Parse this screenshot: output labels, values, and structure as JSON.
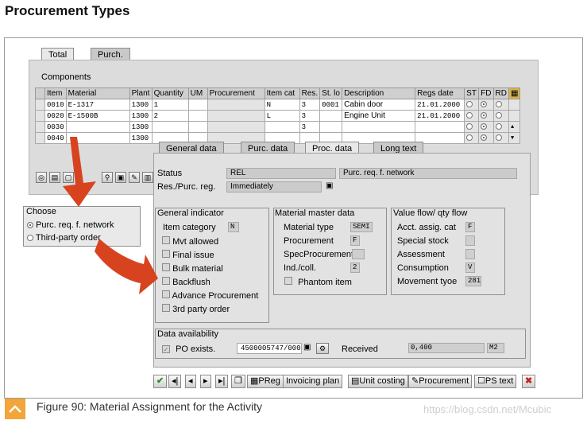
{
  "page_title": "Procurement Types",
  "back_tabs": {
    "total": "Total",
    "purch": "Purch."
  },
  "components_title": "Components",
  "grid": {
    "headers": [
      "Item",
      "Material",
      "Plant",
      "Quantity",
      "UM",
      "Procurement",
      "Item cat",
      "Res.",
      "St. lo",
      "Description",
      "Regs date",
      "ST",
      "FD",
      "RD"
    ],
    "rows": [
      {
        "item": "0010",
        "material": "E-1317",
        "plant": "1300",
        "qty": "1",
        "cat": "N",
        "res": "3",
        "stlo": "0001",
        "desc": "Cabin door",
        "date": "21.01.2000"
      },
      {
        "item": "0020",
        "material": "E-1500B",
        "plant": "1300",
        "qty": "2",
        "cat": "L",
        "res": "3",
        "stlo": "",
        "desc": "Engine Unit",
        "date": "21.01.2000"
      },
      {
        "item": "0030",
        "material": "",
        "plant": "1300",
        "qty": "",
        "cat": "",
        "res": "3",
        "stlo": "",
        "desc": "",
        "date": ""
      },
      {
        "item": "0040",
        "material": "",
        "plant": "1300",
        "qty": "",
        "cat": "",
        "res": "",
        "stlo": "",
        "desc": "",
        "date": ""
      }
    ]
  },
  "choose": {
    "title": "Choose",
    "options": [
      "Purc. req. f. network",
      "Third-party order"
    ]
  },
  "front_tabs": {
    "general": "General data",
    "purc": "Purc. data",
    "proc": "Proc. data",
    "long": "Long text"
  },
  "status": {
    "label": "Status",
    "value": "REL",
    "desc": "Purc. req. f. network"
  },
  "res_purc": {
    "label": "Res./Purc. reg.",
    "value": "Immediately"
  },
  "general_indicator": {
    "title": "General indicator",
    "item_category_label": "Item category",
    "item_category_value": "N",
    "checks": [
      "Mvt allowed",
      "Final issue",
      "Bulk material",
      "Backflush",
      "Advance Procurement",
      "3rd party order"
    ]
  },
  "material_master": {
    "title": "Material master data",
    "material_type_label": "Material type",
    "material_type_value": "SEMI",
    "procurement_label": "Procurement",
    "procurement_value": "F",
    "spec_label": "SpecProcurement",
    "indcoll_label": "Ind./coll.",
    "indcoll_value": "2",
    "phantom_label": "Phantom item"
  },
  "value_flow": {
    "title": "Value flow/ qty flow",
    "acct_label": "Acct. assig. cat",
    "acct_value": "F",
    "special_label": "Special stock",
    "assessment_label": "Assessment",
    "consumption_label": "Consumption",
    "consumption_value": "V",
    "movement_label": "Movement tyoe",
    "movement_value": "281"
  },
  "data_availability": {
    "title": "Data availability",
    "po_label": "PO exists.",
    "po_value": "4500005747/000",
    "received_label": "Received",
    "received_value": "0,400",
    "received_unit": "M2"
  },
  "button_bar": {
    "preg": "PReg",
    "invoicing": "Invoicing plan",
    "unit_costing": "Unit costing",
    "procurement": "Procurement",
    "ps_text": "PS text"
  },
  "caption": "Figure 90: Material Assignment for the Activity",
  "watermark": "https://blog.csdn.net/Mcubic",
  "colors": {
    "arrow": "#d8431f",
    "caption_icon": "#f2a53a"
  }
}
